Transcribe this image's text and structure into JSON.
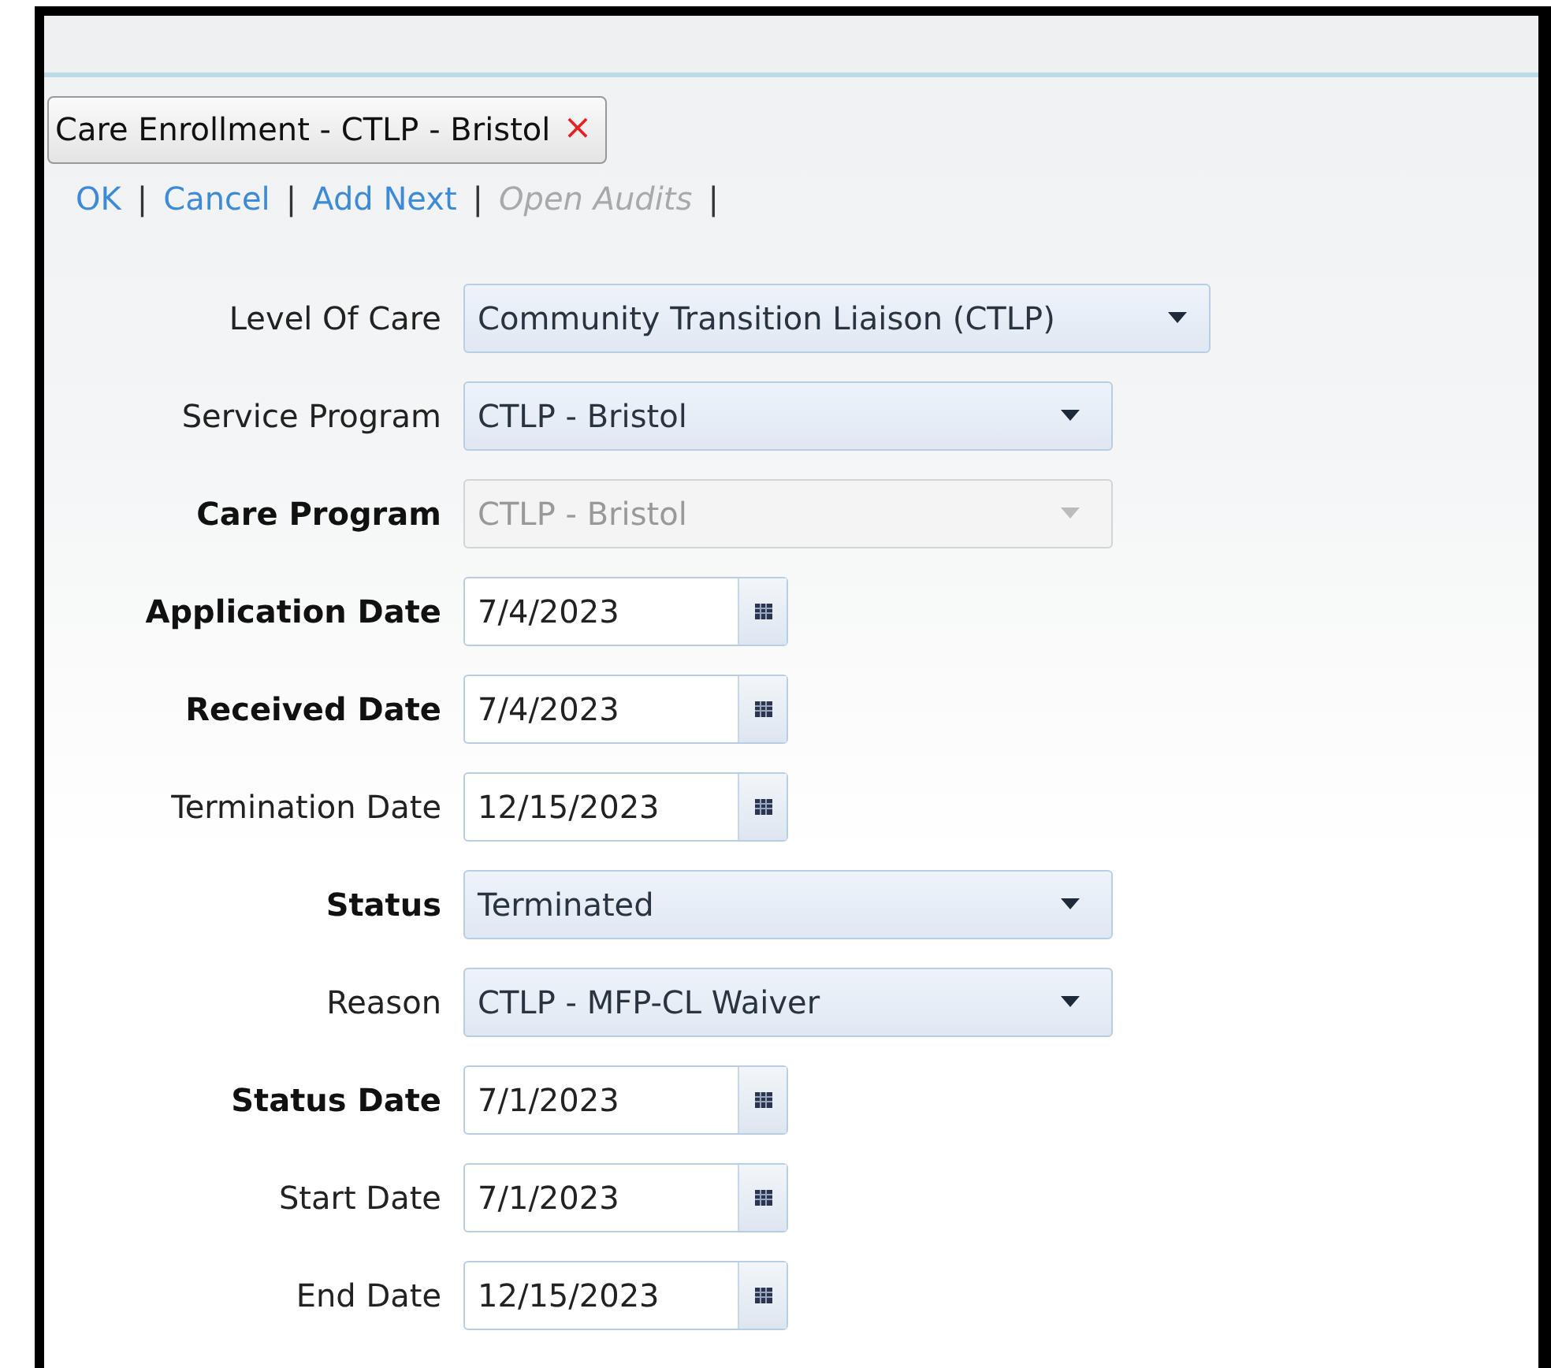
{
  "tab": {
    "label": "Care Enrollment - CTLP - Bristol",
    "close": "×"
  },
  "actions": [
    {
      "label": "OK",
      "disabled": false,
      "separator": "|"
    },
    {
      "label": "Cancel",
      "disabled": false,
      "separator": "|"
    },
    {
      "label": "Add Next",
      "disabled": false,
      "separator": "|"
    },
    {
      "label": "Open Audits",
      "disabled": true,
      "separator": "|"
    }
  ],
  "fields": [
    {
      "label": "Level Of Care",
      "kind": "select",
      "required": false,
      "disabled": false,
      "wide": true,
      "value": "Community Transition Liaison (CTLP)"
    },
    {
      "label": "Service Program",
      "kind": "select",
      "required": false,
      "disabled": false,
      "wide": false,
      "value": "CTLP - Bristol"
    },
    {
      "label": "Care Program",
      "kind": "select",
      "required": true,
      "disabled": true,
      "wide": false,
      "value": "CTLP - Bristol"
    },
    {
      "label": "Application Date",
      "kind": "date",
      "required": true,
      "value": "7/4/2023"
    },
    {
      "label": "Received Date",
      "kind": "date",
      "required": true,
      "value": "7/4/2023"
    },
    {
      "label": "Termination Date",
      "kind": "date",
      "required": false,
      "value": "12/15/2023"
    },
    {
      "label": "Status",
      "kind": "select",
      "required": true,
      "disabled": false,
      "wide": false,
      "value": "Terminated"
    },
    {
      "label": "Reason",
      "kind": "select",
      "required": false,
      "disabled": false,
      "wide": false,
      "value": "CTLP - MFP-CL Waiver"
    },
    {
      "label": "Status Date",
      "kind": "date",
      "required": true,
      "value": "7/1/2023"
    },
    {
      "label": "Start Date",
      "kind": "date",
      "required": false,
      "value": "7/1/2023"
    },
    {
      "label": "End Date",
      "kind": "date",
      "required": false,
      "value": "12/15/2023"
    }
  ]
}
